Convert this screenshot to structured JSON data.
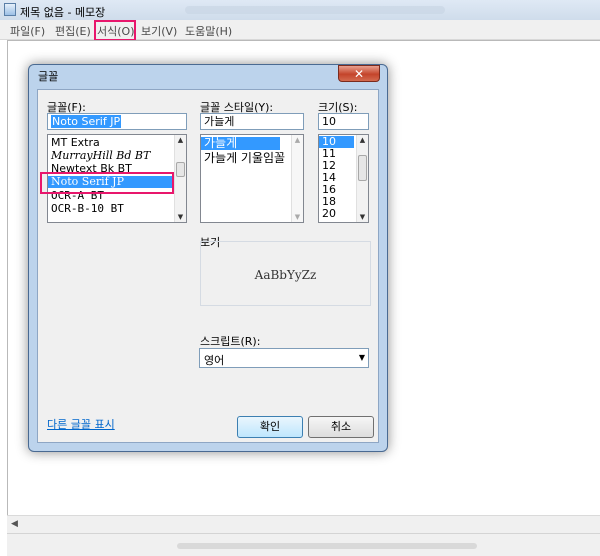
{
  "window": {
    "title": "제목 없음 - 메모장"
  },
  "menu": [
    "파일(F)",
    "편집(E)",
    "서식(O)",
    "보기(V)",
    "도움말(H)"
  ],
  "dialog": {
    "title": "글꼴",
    "close_glyph": "✕",
    "font_label": "글꼴(F):",
    "font_value": "Noto Serif JP",
    "font_list": [
      "MT Extra",
      "MurrayHill Bd BT",
      "Newtext Bk BT",
      "Noto Serif JP",
      "OCR-A BT",
      "OCR-B-10 BT"
    ],
    "selected_font_index": 3,
    "style_label": "글꼴 스타일(Y):",
    "style_value": "가늘게",
    "style_list": [
      "가늘게",
      "가늘게 기울임꼴"
    ],
    "selected_style_index": 0,
    "size_label": "크기(S):",
    "size_value": "10",
    "size_list": [
      "10",
      "11",
      "12",
      "14",
      "16",
      "18",
      "20"
    ],
    "selected_size_index": 0,
    "preview_label": "보기",
    "preview_text": "AaBbYyZz",
    "script_label": "스크립트(R):",
    "script_value": "영어",
    "more_fonts_link": "다른 글꼴 표시",
    "ok_label": "확인",
    "cancel_label": "취소"
  },
  "colors": {
    "highlight_box": "#e8176c",
    "selection": "#3399ff",
    "link": "#0066cc"
  }
}
